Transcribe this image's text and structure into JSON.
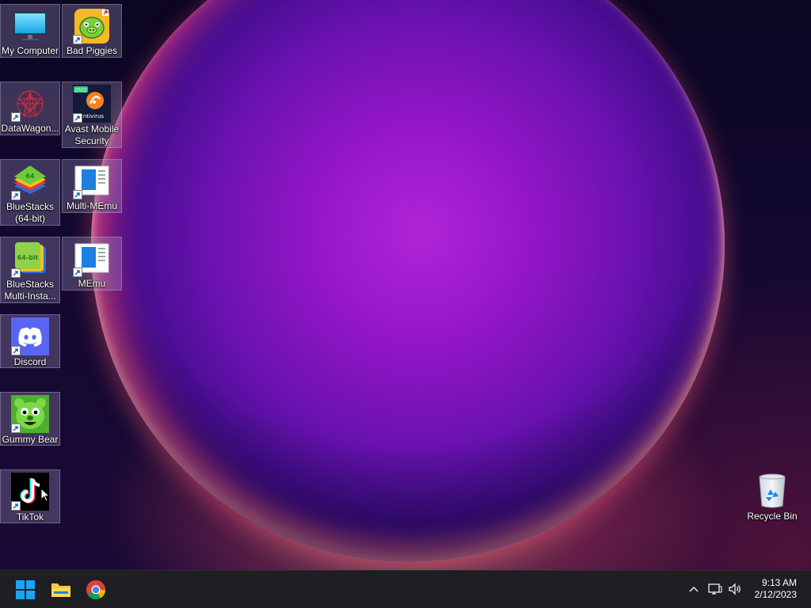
{
  "desktop": {
    "icons": [
      {
        "label": "My Computer",
        "icon": "monitor-icon"
      },
      {
        "label": "Bad Piggies",
        "icon": "bad-piggies-icon"
      },
      {
        "label": "DataWagon...",
        "icon": "datawagon-icon"
      },
      {
        "label": "Avast Mobile Security",
        "icon": "avast-icon",
        "badge": "2022",
        "caption": "ntivirus"
      },
      {
        "label": "BlueStacks (64-bit)",
        "icon": "bluestacks-icon",
        "badge": "64"
      },
      {
        "label": "Multi-MEmu",
        "icon": "memu-icon"
      },
      {
        "label": "BlueStacks Multi-Insta...",
        "icon": "bluestacks-multi-icon",
        "badge": "64-bit"
      },
      {
        "label": "MEmu",
        "icon": "memu-icon"
      },
      {
        "label": "Discord",
        "icon": "discord-icon"
      },
      {
        "label": "Gummy Bear",
        "icon": "gummy-bear-icon"
      },
      {
        "label": "TikTok",
        "icon": "tiktok-icon"
      },
      {
        "label": "Recycle Bin",
        "icon": "recycle-bin-icon"
      }
    ]
  },
  "taskbar": {
    "pinned": [
      {
        "name": "Start",
        "icon": "windows-start-icon"
      },
      {
        "name": "File Explorer",
        "icon": "folder-icon"
      },
      {
        "name": "Google Chrome",
        "icon": "chrome-icon"
      }
    ],
    "tray": {
      "icons": [
        "chevron-up-icon",
        "network-icon",
        "volume-icon"
      ]
    },
    "clock": {
      "time": "9:13 AM",
      "date": "2/12/2023"
    }
  },
  "colors": {
    "taskbar": "#1f1f23",
    "windows_blue": "#1e90ff",
    "discord": "#5865f2",
    "sphere": "#9617c9"
  }
}
